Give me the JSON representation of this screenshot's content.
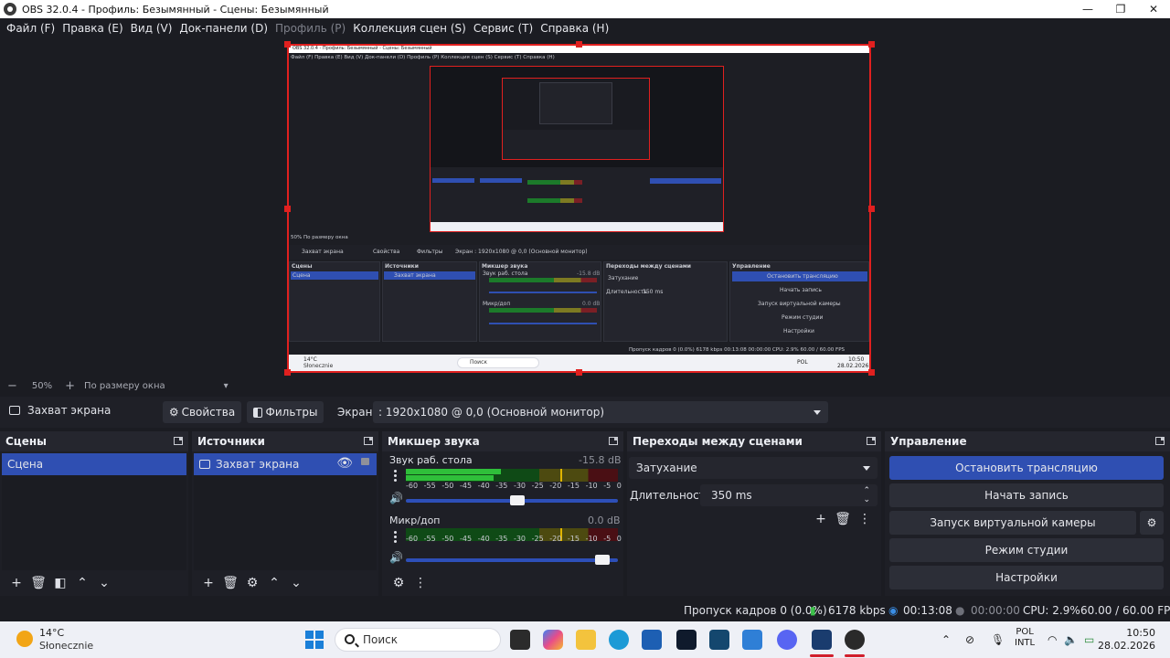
{
  "window": {
    "title": "OBS 32.0.4 - Профиль: Безымянный - Сцены: Безымянный",
    "minimize": "—",
    "maximize": "❐",
    "close": "✕"
  },
  "menu": [
    {
      "label": "Файл (F)",
      "disabled": false
    },
    {
      "label": "Правка (E)",
      "disabled": false
    },
    {
      "label": "Вид (V)",
      "disabled": false
    },
    {
      "label": "Док-панели (D)",
      "disabled": false
    },
    {
      "label": "Профиль (P)",
      "disabled": true
    },
    {
      "label": "Коллекция сцен (S)",
      "disabled": false
    },
    {
      "label": "Сервис (T)",
      "disabled": false
    },
    {
      "label": "Справка (H)",
      "disabled": false
    }
  ],
  "zoom": {
    "minus": "−",
    "value": "50%",
    "plus": "+",
    "mode": "По размеру окна",
    "arrow": "▾"
  },
  "source_toolbar": {
    "source_name": "Захват экрана",
    "properties": "Свойства",
    "filters": "Фильтры",
    "screen_label": "Экран",
    "screen_value": ": 1920x1080 @ 0,0 (Основной монитор)"
  },
  "scenes": {
    "title": "Сцены",
    "items": [
      "Сцена"
    ]
  },
  "sources": {
    "title": "Источники",
    "items": [
      "Захват экрана"
    ]
  },
  "mixer": {
    "title": "Микшер звука",
    "scale": [
      "-60",
      "-55",
      "-50",
      "-45",
      "-40",
      "-35",
      "-30",
      "-25",
      "-20",
      "-15",
      "-10",
      "-5",
      "0"
    ],
    "channels": [
      {
        "name": "Звук раб. стола",
        "db": "-15.8 dB",
        "level": 0.45,
        "peak": 0.73,
        "volume": 0.53
      },
      {
        "name": "Микр/доп",
        "db": "0.0 dB",
        "level": 0.0,
        "peak": 0.73,
        "volume": 0.96
      }
    ]
  },
  "transitions": {
    "title": "Переходы между сценами",
    "type": "Затухание",
    "duration_label": "Длительность",
    "duration_value": "350 ms"
  },
  "controls": {
    "title": "Управление",
    "stop_stream": "Остановить трансляцию",
    "start_record": "Начать запись",
    "virtual_cam": "Запуск виртуальной камеры",
    "studio_mode": "Режим студии",
    "settings": "Настройки"
  },
  "status": {
    "dropped": "Пропуск кадров 0 (0.0%)",
    "bitrate": "6178 kbps",
    "stream_time": "00:13:08",
    "record_time": "00:00:00",
    "cpu": "CPU: 2.9%",
    "fps": "60.00 / 60.00 FPS"
  },
  "taskbar": {
    "temp": "14°C",
    "condition": "Słonecznie",
    "search": "Поиск",
    "lang_top": "POL",
    "lang_bottom": "INTL",
    "time": "10:50",
    "date": "28.02.2026"
  },
  "preview_inner": {
    "title": "OBS 32.0.4 - Профиль: Безымянный - Сцены: Безымянный",
    "menu": "Файл (F)   Правка (E)   Вид (V)   Док-панели (D)   Профиль (P)   Коллекция сцен (S)   Сервис (T)   Справка (H)",
    "zoom": "50%    По размеру окна",
    "src": "Захват экрана",
    "props": "Свойства",
    "filters": "Фильтры",
    "screen": "Экран   : 1920x1080 @ 0,0 (Основной монитор)",
    "scenes": "Сцены",
    "scene": "Сцена",
    "sources": "Источники",
    "source": "Захват экрана",
    "mixer": "Микшер звука",
    "ch1": "Звук раб. стола",
    "ch1db": "-15.8 dB",
    "ch2": "Микр/доп",
    "ch2db": "0.0 dB",
    "trans": "Переходы между сценами",
    "fade": "Затухание",
    "dur": "Длительность",
    "durv": "350 ms",
    "ctrl": "Управление",
    "b1": "Остановить трансляцию",
    "b2": "Начать запись",
    "b3": "Запуск виртуальной камеры",
    "b4": "Режим студии",
    "b5": "Настройки",
    "status": "Пропуск кадров 0 (0.0%)   6178 kbps   00:13:08   00:00:00   CPU: 2.9%   60.00 / 60.00 FPS",
    "temp": "14°C",
    "cond": "Słonecznie",
    "search": "Поиск",
    "lang": "POL",
    "time": "10:50",
    "date": "28.02.2026"
  },
  "colors": {
    "accent": "#2f4fb2",
    "selection_border": "#e0201f",
    "background": "#1b1c22"
  }
}
